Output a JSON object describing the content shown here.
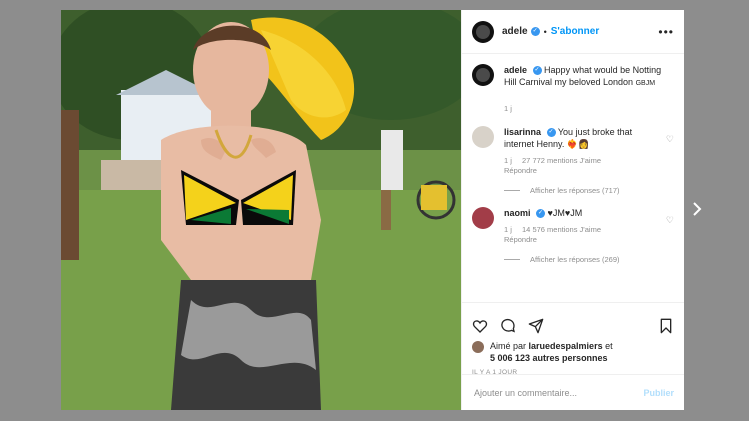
{
  "post": {
    "author": "adele",
    "follow_label": "S'abonner",
    "dot": "•",
    "caption": "Happy what would be Notting Hill Carnival my beloved London",
    "caption_tag": "GBJM",
    "caption_age": "1 j"
  },
  "comments": [
    {
      "user": "lisarinna",
      "text": "You just broke that internet Henny. ❤️‍🔥👩",
      "age": "1 j",
      "likes": "27 772 mentions J'aime",
      "reply": "Répondre",
      "view_replies": "Afficher les réponses (717)"
    },
    {
      "user": "naomi",
      "text": "♥JM♥JM",
      "age": "1 j",
      "likes": "14 576 mentions J'aime",
      "reply": "Répondre",
      "view_replies": "Afficher les réponses (269)"
    }
  ],
  "likes": {
    "prefix": "Aimé par",
    "user": "laruedespalmiers",
    "conj": "et",
    "count": "5 006 123 autres personnes"
  },
  "time_ago": "IL Y A 1 JOUR",
  "add_comment": {
    "placeholder": "Ajouter un commentaire...",
    "publish_label": "Publier"
  },
  "colors": {
    "accent": "#0095f6",
    "verified": "#3897f0"
  }
}
